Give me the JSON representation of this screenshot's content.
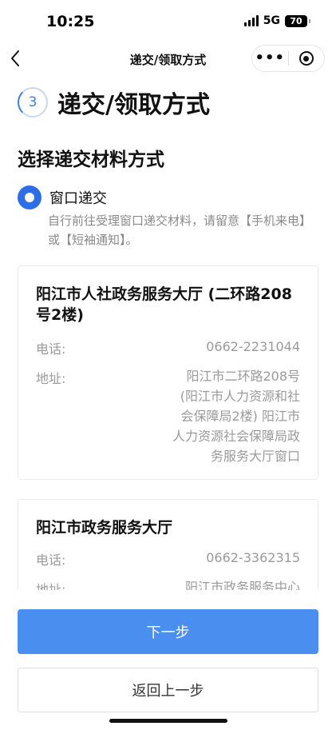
{
  "status_bar": {
    "time": "10:25",
    "network": "5G",
    "battery": "70"
  },
  "nav": {
    "title": "递交/领取方式",
    "more": "•••"
  },
  "step": {
    "number": "3",
    "title": "递交/领取方式"
  },
  "section_title": "选择递交材料方式",
  "option": {
    "label": "窗口递交",
    "selected": true,
    "description": "自行前往受理窗口递交材料，请留意【手机来电】或【短袖通知】。"
  },
  "offices": [
    {
      "name": "阳江市人社政务服务大厅 (二环路208号2楼)",
      "phone_label": "电话:",
      "phone": "0662-2231044",
      "address_label": "地址:",
      "address_lines": [
        "阳江市二环路208号",
        "(阳江市人力资源和社",
        "会保障局2楼) 阳江市",
        "人力资源社会保障局政",
        "务服务大厅窗口"
      ]
    },
    {
      "name": "阳江市政务服务大厅",
      "phone_label": "电话:",
      "phone": "0662-3362315",
      "address_label": "地址:",
      "address_lines": [
        "阳江市政务服务中心"
      ]
    }
  ],
  "buttons": {
    "next": "下一步",
    "back": "返回上一步"
  },
  "colors": {
    "primary": "#4a8ef0",
    "radio": "#2d6ee6",
    "muted": "#8a8a8a"
  }
}
